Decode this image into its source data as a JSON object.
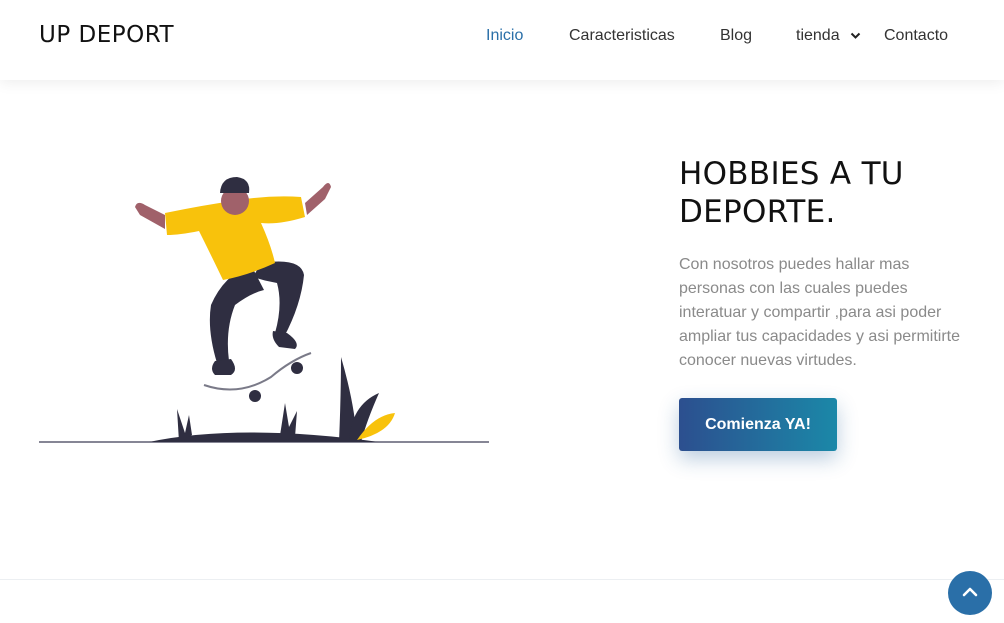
{
  "header": {
    "logo": "UP DEPORT",
    "nav": [
      {
        "label": "Inicio",
        "active": true
      },
      {
        "label": "Caracteristicas",
        "active": false
      },
      {
        "label": "Blog",
        "active": false
      },
      {
        "label": "tienda",
        "active": false,
        "dropdown": true
      },
      {
        "label": "Contacto",
        "active": false
      }
    ]
  },
  "hero": {
    "title": "HOBBIES A TU DEPORTE.",
    "description": "Con nosotros puedes hallar mas personas con las cuales puedes interatuar y compartir ,para asi poder ampliar tus capacidades y asi permitirte conocer nuevas virtudes.",
    "cta_label": "Comienza YA!"
  },
  "colors": {
    "accent": "#2a6fa8",
    "cta_gradient_start": "#2c4f8f",
    "cta_gradient_end": "#1b88a8",
    "illustration_yellow": "#f8c20c",
    "illustration_dark": "#2f2e41"
  },
  "icons": {
    "dropdown": "chevron-down-icon",
    "back_to_top": "chevron-up-icon"
  }
}
